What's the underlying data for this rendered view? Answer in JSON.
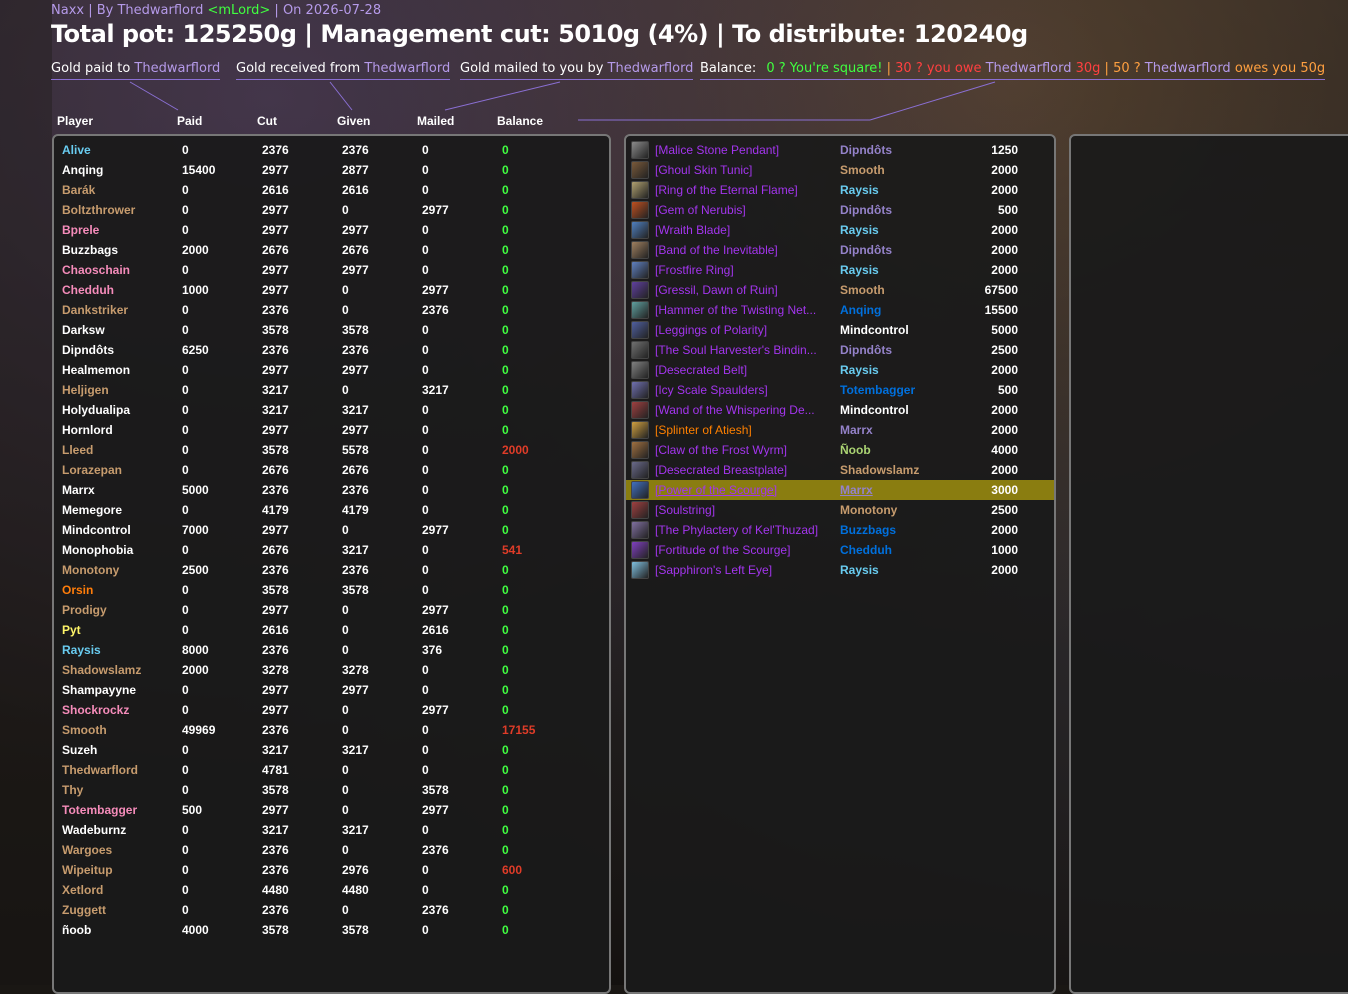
{
  "header": {
    "raid": "Naxx",
    "by_prefix": " | By ",
    "author": "Thedwarflord",
    "guild": "<mLord>",
    "on_prefix": " | On ",
    "date": "2026-07-28",
    "summary": "Total pot: 125250g | Management cut: 5010g (4%) | To distribute: 120240g"
  },
  "gold_links": {
    "paid_label": "Gold paid to ",
    "paid_name": "Thedwarflord",
    "received_label": "Gold received from ",
    "received_name": "Thedwarflord",
    "mailed_label": "Gold mailed to you by ",
    "mailed_name": "Thedwarflord"
  },
  "balance_legend": {
    "label": "Balance:",
    "square": "0 ? You're square!",
    "sep1": " | ",
    "owe_prefix": "30 ? you owe ",
    "owe_name": "Thedwarflord",
    "owe_amount": " 30g",
    "sep2": " | ",
    "owes_prefix": "50 ? ",
    "owes_name": "Thedwarflord",
    "owes_suffix": " owes you 50g"
  },
  "columns": [
    "Player",
    "Paid",
    "Cut",
    "Given",
    "Mailed",
    "Balance"
  ],
  "players": [
    {
      "name": "Alive",
      "class": "mage",
      "paid": "0",
      "cut": "2376",
      "given": "2376",
      "mailed": "0",
      "balance": "0"
    },
    {
      "name": "Anqing",
      "class": "white",
      "paid": "15400",
      "cut": "2977",
      "given": "2877",
      "mailed": "0",
      "balance": "0"
    },
    {
      "name": "Barák",
      "class": "warrior",
      "paid": "0",
      "cut": "2616",
      "given": "2616",
      "mailed": "0",
      "balance": "0"
    },
    {
      "name": "Boltzthrower",
      "class": "warrior",
      "paid": "0",
      "cut": "2977",
      "given": "0",
      "mailed": "2977",
      "balance": "0"
    },
    {
      "name": "Bprele",
      "class": "paladin",
      "paid": "0",
      "cut": "2977",
      "given": "2977",
      "mailed": "0",
      "balance": "0"
    },
    {
      "name": "Buzzbags",
      "class": "white",
      "paid": "2000",
      "cut": "2676",
      "given": "2676",
      "mailed": "0",
      "balance": "0"
    },
    {
      "name": "Chaoschain",
      "class": "paladin",
      "paid": "0",
      "cut": "2977",
      "given": "2977",
      "mailed": "0",
      "balance": "0"
    },
    {
      "name": "Chedduh",
      "class": "paladin",
      "paid": "1000",
      "cut": "2977",
      "given": "0",
      "mailed": "2977",
      "balance": "0"
    },
    {
      "name": "Dankstriker",
      "class": "warrior",
      "paid": "0",
      "cut": "2376",
      "given": "0",
      "mailed": "2376",
      "balance": "0"
    },
    {
      "name": "Darksw",
      "class": "white",
      "paid": "0",
      "cut": "3578",
      "given": "3578",
      "mailed": "0",
      "balance": "0"
    },
    {
      "name": "Dipndôts",
      "class": "white",
      "paid": "6250",
      "cut": "2376",
      "given": "2376",
      "mailed": "0",
      "balance": "0"
    },
    {
      "name": "Healmemon",
      "class": "white",
      "paid": "0",
      "cut": "2977",
      "given": "2977",
      "mailed": "0",
      "balance": "0"
    },
    {
      "name": "Heljigen",
      "class": "warrior",
      "paid": "0",
      "cut": "3217",
      "given": "0",
      "mailed": "3217",
      "balance": "0"
    },
    {
      "name": "Holydualipa",
      "class": "white",
      "paid": "0",
      "cut": "3217",
      "given": "3217",
      "mailed": "0",
      "balance": "0"
    },
    {
      "name": "Hornlord",
      "class": "white",
      "paid": "0",
      "cut": "2977",
      "given": "2977",
      "mailed": "0",
      "balance": "0"
    },
    {
      "name": "Lleed",
      "class": "warrior",
      "paid": "0",
      "cut": "3578",
      "given": "5578",
      "mailed": "0",
      "balance": "2000"
    },
    {
      "name": "Lorazepan",
      "class": "warrior",
      "paid": "0",
      "cut": "2676",
      "given": "2676",
      "mailed": "0",
      "balance": "0"
    },
    {
      "name": "Marrx",
      "class": "white",
      "paid": "5000",
      "cut": "2376",
      "given": "2376",
      "mailed": "0",
      "balance": "0"
    },
    {
      "name": "Memegore",
      "class": "white",
      "paid": "0",
      "cut": "4179",
      "given": "4179",
      "mailed": "0",
      "balance": "0"
    },
    {
      "name": "Mindcontrol",
      "class": "white",
      "paid": "7000",
      "cut": "2977",
      "given": "0",
      "mailed": "2977",
      "balance": "0"
    },
    {
      "name": "Monophobia",
      "class": "white",
      "paid": "0",
      "cut": "2676",
      "given": "3217",
      "mailed": "0",
      "balance": "541"
    },
    {
      "name": "Monotony",
      "class": "warrior",
      "paid": "2500",
      "cut": "2376",
      "given": "2376",
      "mailed": "0",
      "balance": "0"
    },
    {
      "name": "Orsin",
      "class": "druid",
      "paid": "0",
      "cut": "3578",
      "given": "3578",
      "mailed": "0",
      "balance": "0"
    },
    {
      "name": "Prodigy",
      "class": "warrior",
      "paid": "0",
      "cut": "2977",
      "given": "0",
      "mailed": "2977",
      "balance": "0"
    },
    {
      "name": "Pyt",
      "class": "rogue",
      "paid": "0",
      "cut": "2616",
      "given": "0",
      "mailed": "2616",
      "balance": "0"
    },
    {
      "name": "Raysis",
      "class": "mage",
      "paid": "8000",
      "cut": "2376",
      "given": "0",
      "mailed": "376",
      "balance": "0"
    },
    {
      "name": "Shadowslamz",
      "class": "warrior",
      "paid": "2000",
      "cut": "3278",
      "given": "3278",
      "mailed": "0",
      "balance": "0"
    },
    {
      "name": "Shampayyne",
      "class": "white",
      "paid": "0",
      "cut": "2977",
      "given": "2977",
      "mailed": "0",
      "balance": "0"
    },
    {
      "name": "Shockrockz",
      "class": "paladin",
      "paid": "0",
      "cut": "2977",
      "given": "0",
      "mailed": "2977",
      "balance": "0"
    },
    {
      "name": "Smooth",
      "class": "warrior",
      "paid": "49969",
      "cut": "2376",
      "given": "0",
      "mailed": "0",
      "balance": "17155"
    },
    {
      "name": "Suzeh",
      "class": "white",
      "paid": "0",
      "cut": "3217",
      "given": "3217",
      "mailed": "0",
      "balance": "0"
    },
    {
      "name": "Thedwarflord",
      "class": "warrior",
      "paid": "0",
      "cut": "4781",
      "given": "0",
      "mailed": "0",
      "balance": "0"
    },
    {
      "name": "Thy",
      "class": "warrior",
      "paid": "0",
      "cut": "3578",
      "given": "0",
      "mailed": "3578",
      "balance": "0"
    },
    {
      "name": "Totembagger",
      "class": "paladin",
      "paid": "500",
      "cut": "2977",
      "given": "0",
      "mailed": "2977",
      "balance": "0"
    },
    {
      "name": "Wadeburnz",
      "class": "white",
      "paid": "0",
      "cut": "3217",
      "given": "3217",
      "mailed": "0",
      "balance": "0"
    },
    {
      "name": "Wargoes",
      "class": "warrior",
      "paid": "0",
      "cut": "2376",
      "given": "0",
      "mailed": "2376",
      "balance": "0"
    },
    {
      "name": "Wipeitup",
      "class": "warrior",
      "paid": "0",
      "cut": "2376",
      "given": "2976",
      "mailed": "0",
      "balance": "600"
    },
    {
      "name": "Xetlord",
      "class": "warrior",
      "paid": "0",
      "cut": "4480",
      "given": "4480",
      "mailed": "0",
      "balance": "0"
    },
    {
      "name": "Zuggett",
      "class": "warrior",
      "paid": "0",
      "cut": "2376",
      "given": "0",
      "mailed": "2376",
      "balance": "0"
    },
    {
      "name": "ñoob",
      "class": "white",
      "paid": "4000",
      "cut": "3578",
      "given": "3578",
      "mailed": "0",
      "balance": "0"
    }
  ],
  "loot": [
    {
      "item": "[Malice Stone Pendant]",
      "winner": "Dipndôts",
      "winner_class": "warlock",
      "amount": "1250",
      "legendary": false,
      "icon_color": "#8a8a8a"
    },
    {
      "item": "[Ghoul Skin Tunic]",
      "winner": "Smooth",
      "winner_class": "warrior",
      "amount": "2000",
      "legendary": false,
      "icon_color": "#7a5a3a"
    },
    {
      "item": "[Ring of the Eternal Flame]",
      "winner": "Raysis",
      "winner_class": "mage",
      "amount": "2000",
      "legendary": false,
      "icon_color": "#b0a070"
    },
    {
      "item": "[Gem of Nerubis]",
      "winner": "Dipndôts",
      "winner_class": "warlock",
      "amount": "500",
      "legendary": false,
      "icon_color": "#c05020"
    },
    {
      "item": "[Wraith Blade]",
      "winner": "Raysis",
      "winner_class": "mage",
      "amount": "2000",
      "legendary": false,
      "icon_color": "#5080c0"
    },
    {
      "item": "[Band of the Inevitable]",
      "winner": "Dipndôts",
      "winner_class": "warlock",
      "amount": "2000",
      "legendary": false,
      "icon_color": "#a08060"
    },
    {
      "item": "[Frostfire Ring]",
      "winner": "Raysis",
      "winner_class": "mage",
      "amount": "2000",
      "legendary": false,
      "icon_color": "#6080c0"
    },
    {
      "item": "[Gressil, Dawn of Ruin]",
      "winner": "Smooth",
      "winner_class": "warrior",
      "amount": "67500",
      "legendary": false,
      "icon_color": "#6040a0"
    },
    {
      "item": "[Hammer of the Twisting Net...",
      "winner": "Anqing",
      "winner_class": "shaman",
      "amount": "15500",
      "legendary": false,
      "icon_color": "#60a0a0"
    },
    {
      "item": "[Leggings of Polarity]",
      "winner": "Mindcontrol",
      "winner_class": "priest",
      "amount": "5000",
      "legendary": false,
      "icon_color": "#5060a0"
    },
    {
      "item": "[The Soul Harvester's Bindin...",
      "winner": "Dipndôts",
      "winner_class": "warlock",
      "amount": "2500",
      "legendary": false,
      "icon_color": "#707070"
    },
    {
      "item": "[Desecrated Belt]",
      "winner": "Raysis",
      "winner_class": "mage",
      "amount": "2000",
      "legendary": false,
      "icon_color": "#808080"
    },
    {
      "item": "[Icy Scale Spaulders]",
      "winner": "Totembagger",
      "winner_class": "shaman",
      "amount": "500",
      "legendary": false,
      "icon_color": "#7070b0"
    },
    {
      "item": "[Wand of the Whispering De...",
      "winner": "Mindcontrol",
      "winner_class": "priest",
      "amount": "2000",
      "legendary": false,
      "icon_color": "#a04040"
    },
    {
      "item": "[Splinter of Atiesh]",
      "winner": "Marrx",
      "winner_class": "warlock",
      "amount": "2000",
      "legendary": true,
      "icon_color": "#d0a040"
    },
    {
      "item": "[Claw of the Frost Wyrm]",
      "winner": "Ñoob",
      "winner_class": "hunter",
      "amount": "4000",
      "legendary": false,
      "icon_color": "#a07040"
    },
    {
      "item": "[Desecrated Breastplate]",
      "winner": "Shadowslamz",
      "winner_class": "warrior",
      "amount": "2000",
      "legendary": false,
      "icon_color": "#6a6a8a"
    },
    {
      "item": "[Power of the Scourge]",
      "winner": "Marrx",
      "winner_class": "warlock",
      "amount": "3000",
      "legendary": false,
      "icon_color": "#4070c0",
      "selected": true
    },
    {
      "item": "[Soulstring]",
      "winner": "Monotony",
      "winner_class": "warrior",
      "amount": "2500",
      "legendary": false,
      "icon_color": "#a04040"
    },
    {
      "item": "[The Phylactery of Kel'Thuzad]",
      "winner": "Buzzbags",
      "winner_class": "shaman",
      "amount": "2000",
      "legendary": false,
      "icon_color": "#8070a0"
    },
    {
      "item": "[Fortitude of the Scourge]",
      "winner": "Chedduh",
      "winner_class": "shaman",
      "amount": "1000",
      "legendary": false,
      "icon_color": "#8040c0"
    },
    {
      "item": "[Sapphiron's Left Eye]",
      "winner": "Raysis",
      "winner_class": "mage",
      "amount": "2000",
      "legendary": false,
      "icon_color": "#80c0e0"
    }
  ],
  "colors": {
    "balance_ok": "#40ff40",
    "balance_negative": "#e03c28",
    "epic": "#a335ee",
    "legendary": "#ff8000",
    "accent_purple": "#b59ae9",
    "selected_row": "#8a7d10"
  }
}
